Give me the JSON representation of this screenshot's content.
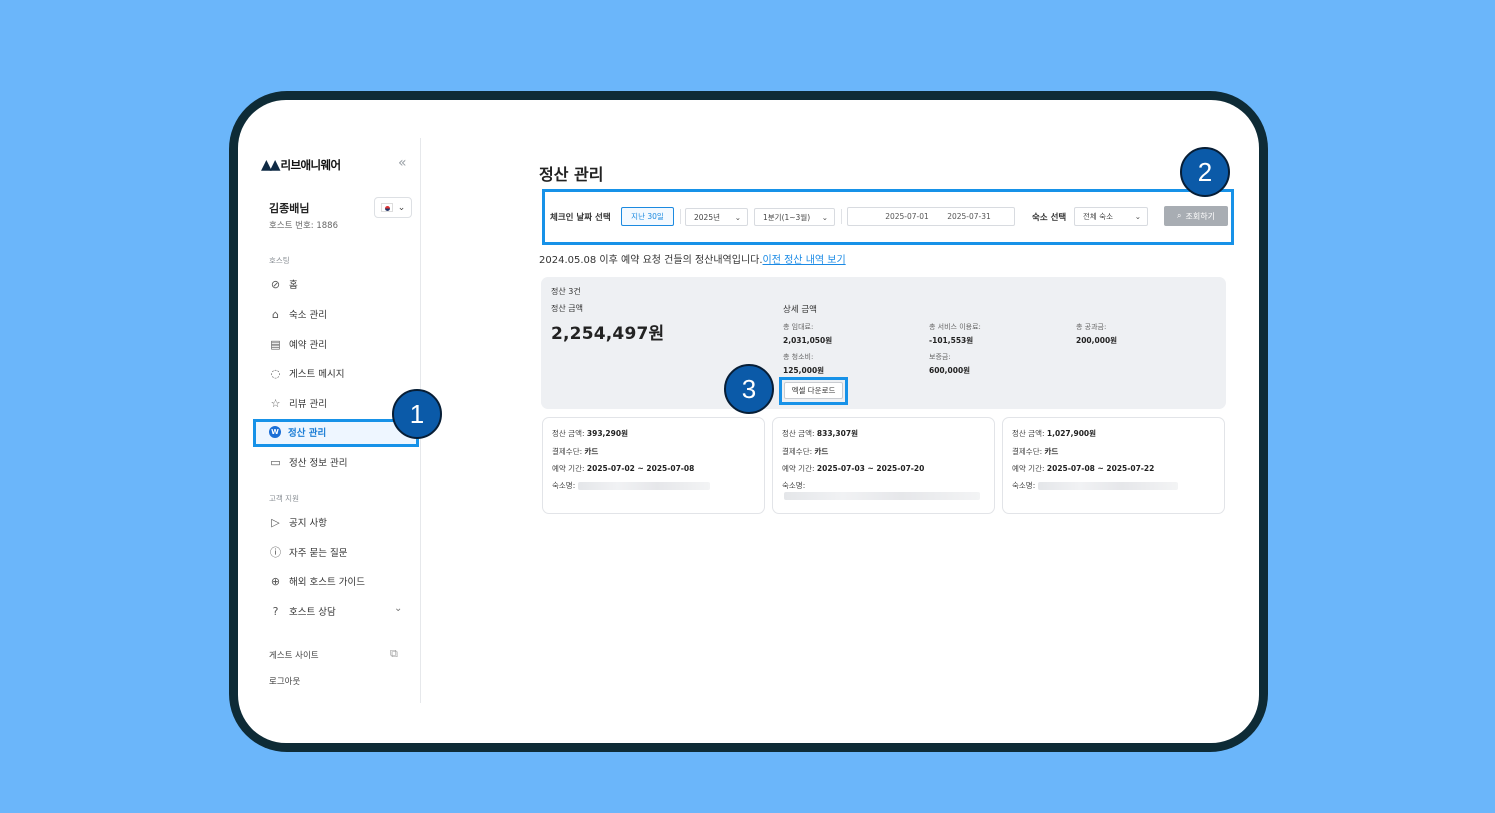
{
  "sidebar": {
    "logo_mark": "▲▲",
    "logo_text": "리브애니웨어",
    "collapse_icon": "«",
    "user_name": "김종배님",
    "host_number": "호스트 번호: 1886",
    "section_hosting": "호스팅",
    "items": [
      {
        "label": "홈",
        "icon": "check-circle-icon"
      },
      {
        "label": "숙소 관리",
        "icon": "house-icon"
      },
      {
        "label": "예약 관리",
        "icon": "clipboard-icon"
      },
      {
        "label": "게스트 메시지",
        "icon": "chat-icon"
      },
      {
        "label": "리뷰 관리",
        "icon": "star-icon"
      },
      {
        "label": "정산 관리",
        "icon": "w-coin-icon",
        "active": true
      },
      {
        "label": "정산 정보 관리",
        "icon": "document-icon"
      }
    ],
    "section_support": "고객 지원",
    "support_items": [
      {
        "label": "공지 사항",
        "icon": "megaphone-icon"
      },
      {
        "label": "자주 묻는 질문",
        "icon": "info-icon"
      },
      {
        "label": "해외 호스트 가이드",
        "icon": "globe-icon"
      },
      {
        "label": "호스트 상담",
        "icon": "help-icon"
      }
    ],
    "guest_site": "게스트 사이트",
    "logout": "로그아웃"
  },
  "main": {
    "title": "정산 관리",
    "filter": {
      "checkin_label": "체크인 날짜 선택",
      "chip_recent": "지난 30일",
      "year_select": "2025년",
      "quarter_select": "1분기(1~3월)",
      "date_from": "2025-07-01",
      "date_to": "2025-07-31",
      "property_label": "숙소 선택",
      "property_select": "전체 숙소",
      "search_button": "조회하기"
    },
    "notice_text": "2024.05.08 이후 예약 요청 건들의 정산내역입니다.",
    "notice_link": "이전 정산 내역 보기",
    "summary": {
      "count": "정산 3건",
      "amount_label": "정산 금액",
      "amount_total": "2,254,497원",
      "detail_title": "상세 금액",
      "details": [
        {
          "label": "총 임대료:",
          "value": "2,031,050원"
        },
        {
          "label": "총 서비스 이용료:",
          "value": "-101,553원"
        },
        {
          "label": "총 공과금:",
          "value": "200,000원"
        },
        {
          "label": "총 청소비:",
          "value": "125,000원"
        },
        {
          "label": "보증금:",
          "value": "600,000원"
        }
      ],
      "excel_button": "엑셀 다운로드"
    },
    "cards": [
      {
        "amount_label": "정산 금액:",
        "amount": "393,290원",
        "method_label": "결제수단:",
        "method": "카드",
        "period_label": "예약 기간:",
        "period": "2025-07-02 ~ 2025-07-08",
        "property_label": "숙소명:"
      },
      {
        "amount_label": "정산 금액:",
        "amount": "833,307원",
        "method_label": "결제수단:",
        "method": "카드",
        "period_label": "예약 기간:",
        "period": "2025-07-03 ~ 2025-07-20",
        "property_label": "숙소명:"
      },
      {
        "amount_label": "정산 금액:",
        "amount": "1,027,900원",
        "method_label": "결제수단:",
        "method": "카드",
        "period_label": "예약 기간:",
        "period": "2025-07-08 ~ 2025-07-22",
        "property_label": "숙소명:"
      }
    ]
  },
  "callouts": [
    "1",
    "2",
    "3"
  ],
  "colors": {
    "background": "#6bb6fa",
    "highlight": "#1792e8",
    "badge": "#0b5aa8",
    "accent": "#1c8ae0"
  }
}
